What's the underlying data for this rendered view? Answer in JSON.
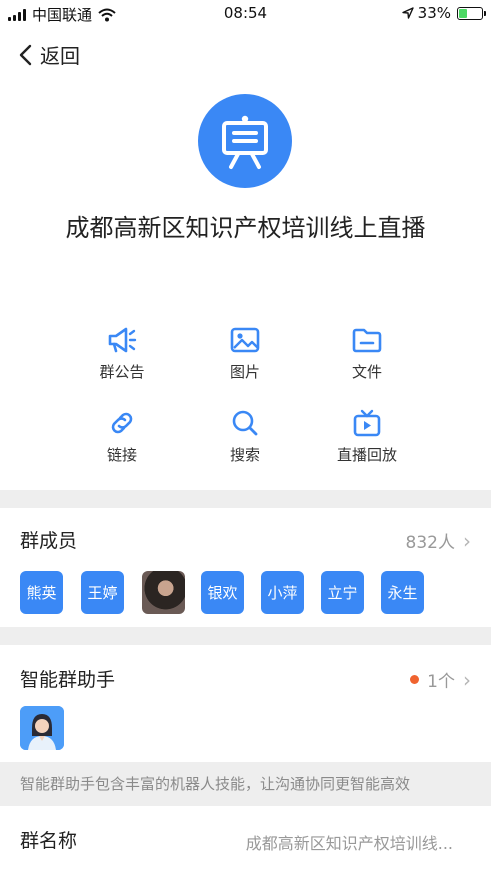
{
  "status_bar": {
    "carrier": "中国联通",
    "time": "08:54",
    "battery_percent": "33%"
  },
  "nav": {
    "back_label": "返回"
  },
  "group": {
    "title": "成都高新区知识产权培训线上直播"
  },
  "actions": [
    {
      "label": "群公告",
      "icon": "megaphone-icon"
    },
    {
      "label": "图片",
      "icon": "image-icon"
    },
    {
      "label": "文件",
      "icon": "folder-icon"
    },
    {
      "label": "链接",
      "icon": "link-icon"
    },
    {
      "label": "搜索",
      "icon": "search-icon"
    },
    {
      "label": "直播回放",
      "icon": "live-replay-icon"
    }
  ],
  "members": {
    "title": "群成员",
    "count": "832人",
    "items": [
      "熊英",
      "王婷",
      "",
      "银欢",
      "小萍",
      "立宁",
      "永生"
    ]
  },
  "assistant": {
    "title": "智能群助手",
    "count": "1个",
    "hint": "智能群助手包含丰富的机器人技能，让沟通协同更智能高效"
  },
  "group_name": {
    "label": "群名称",
    "value": "成都高新区知识产权培训线..."
  },
  "colors": {
    "accent": "#3a88f5",
    "badge": "#f0632f",
    "separator": "#eeeeee"
  }
}
